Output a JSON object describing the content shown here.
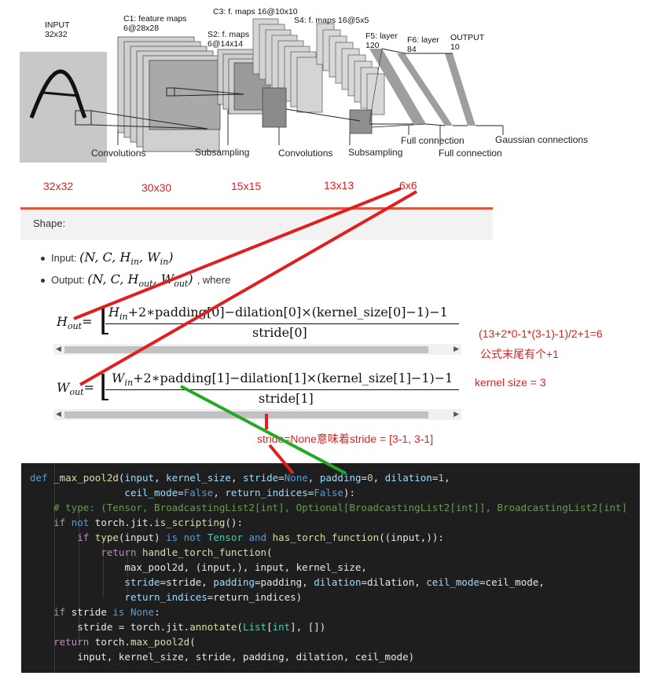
{
  "diagram": {
    "input_label": "INPUT",
    "input_size": "32x32",
    "c1_label": "C1: feature maps",
    "c1_size": "6@28x28",
    "s2_label": "S2: f. maps",
    "s2_size": "6@14x14",
    "c3_label": "C3: f. maps 16@10x10",
    "s4_label": "S4: f. maps 16@5x5",
    "f5_label": "F5: layer",
    "f5_size": "120",
    "f6_label": "F6: layer",
    "f6_size": "84",
    "output_label": "OUTPUT",
    "output_size": "10",
    "captions": [
      "Convolutions",
      "Subsampling",
      "Convolutions",
      "Subsampling",
      "Full connection",
      "Full connection",
      "Gaussian connections"
    ]
  },
  "annotations": {
    "sizes": [
      "32x32",
      "30x30",
      "15x15",
      "13x13",
      "6x6"
    ],
    "formula_note": "(13+2*0-1*(3-1)-1)/2+1=6",
    "formula_note2": "公式末尾有个+1",
    "kernel_note": "kernel  size = 3",
    "stride_note": "stride=None意味着stride = [3-1, 3-1]",
    "colors": {
      "annotation": "#e02020",
      "green_line": "#22aa22"
    }
  },
  "doc": {
    "shape_title": "Shape:",
    "input_bullet": "Input:",
    "input_math": "(N, C, H",
    "output_bullet": "Output:",
    "output_math": "(N, C, H",
    "where": ", where",
    "hout_lhs": "H",
    "wout_lhs": "W",
    "hout_num": "H",
    "hout_num_rest": "+2∗padding[0]−dilation[0]×(kernel_size[0]−1)−1",
    "hout_den": "stride[0]",
    "wout_num": "W",
    "wout_num_rest": "+2∗padding[1]−dilation[1]×(kernel_size[1]−1)−1",
    "wout_den": "stride[1]",
    "sub_in": "in",
    "sub_out": "out"
  },
  "code": {
    "lines": [
      "def _max_pool2d(input, kernel_size, stride=None, padding=0, dilation=1,",
      "                ceil_mode=False, return_indices=False):",
      "    # type: (Tensor, BroadcastingList2[int], Optional[BroadcastingList2[int]], BroadcastingList2[int]",
      "    if not torch.jit.is_scripting():",
      "        if type(input) is not Tensor and has_torch_function((input,)):",
      "            return handle_torch_function(",
      "                max_pool2d, (input,), input, kernel_size,",
      "                stride=stride, padding=padding, dilation=dilation, ceil_mode=ceil_mode,",
      "                return_indices=return_indices)",
      "    if stride is None:",
      "        stride = torch.jit.annotate(List[int], [])",
      "    return torch.max_pool2d(",
      "        input, kernel_size, stride, padding, dilation, ceil_mode)"
    ]
  }
}
